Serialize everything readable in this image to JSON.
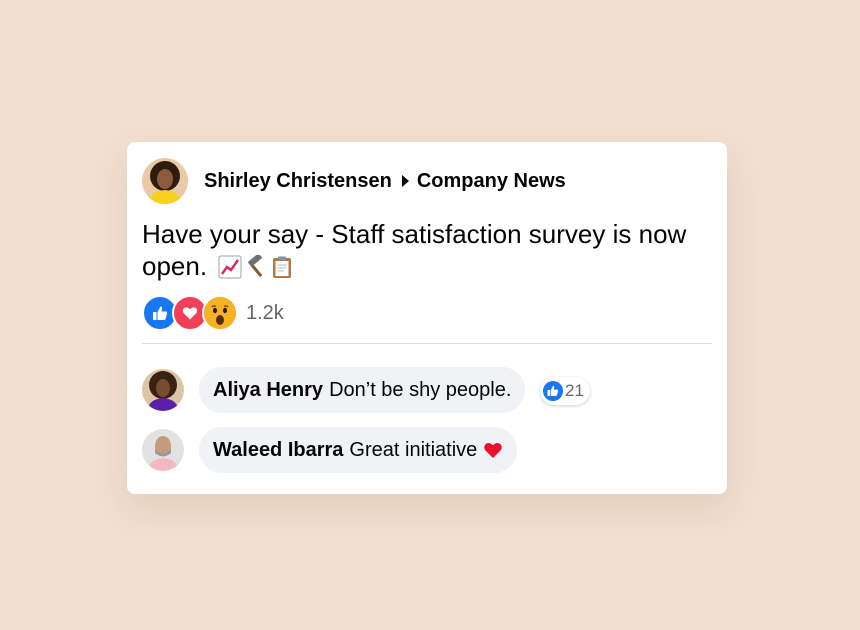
{
  "post": {
    "author": "Shirley Christensen",
    "group": "Company News",
    "text": "Have your say - Staff satisfaction survey is now open.",
    "emojis": [
      "chart-increasing-icon",
      "hammer-icon",
      "clipboard-icon"
    ],
    "reactions": {
      "types": [
        "like-icon",
        "love-icon",
        "wow-icon"
      ],
      "count": "1.2k"
    }
  },
  "comments": [
    {
      "name": "Aliya Henry",
      "text": "Don’t be shy people.",
      "likes": "21"
    },
    {
      "name": "Waleed Ibarra",
      "text": "Great initiative",
      "emoji": "red-heart-icon"
    }
  ],
  "colors": {
    "background": "#f2dfcf",
    "like_blue": "#1877f2",
    "love_red": "#f33e58",
    "wow_yellow": "#f7b125",
    "bubble": "#f0f2f5"
  }
}
